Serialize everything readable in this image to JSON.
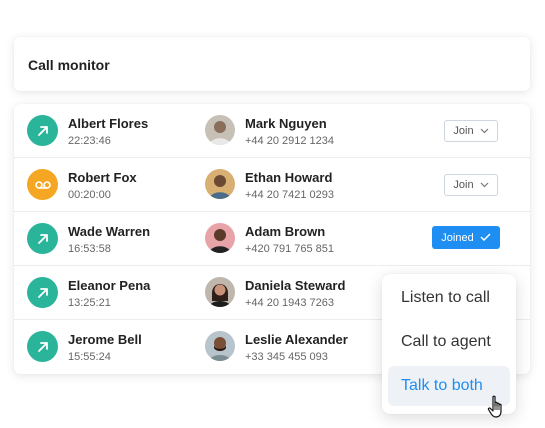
{
  "header": {
    "title": "Call monitor"
  },
  "rows": [
    {
      "caller": "Albert Flores",
      "time": "22:23:46",
      "icon": "outgoing-arrow-icon",
      "icon_color": "#2ab59a",
      "agent": "Mark Nguyen",
      "phone": "+44 20 2912 1234",
      "avatar_color": "#c7c0b6",
      "action": "Join"
    },
    {
      "caller": "Robert Fox",
      "time": "00:20:00",
      "icon": "voicemail-icon",
      "icon_color": "#f5a623",
      "agent": "Ethan Howard",
      "phone": "+44 20 7421 0293",
      "avatar_color": "#d8b073",
      "action": "Join"
    },
    {
      "caller": "Wade Warren",
      "time": "16:53:58",
      "icon": "outgoing-arrow-icon",
      "icon_color": "#2ab59a",
      "agent": "Adam Brown",
      "phone": "+420 791 765 851",
      "avatar_color": "#e7a3a8",
      "action": "Joined"
    },
    {
      "caller": "Eleanor Pena",
      "time": "13:25:21",
      "icon": "outgoing-arrow-icon",
      "icon_color": "#2ab59a",
      "agent": "Daniela Steward",
      "phone": "+44 20 1943 7263",
      "avatar_color": "#bfb6ad",
      "action": ""
    },
    {
      "caller": "Jerome Bell",
      "time": "15:55:24",
      "icon": "outgoing-arrow-icon",
      "icon_color": "#2ab59a",
      "agent": "Leslie Alexander",
      "phone": "+33 345 455 093",
      "avatar_color": "#b7c4cc",
      "action": ""
    }
  ],
  "menu": {
    "items": [
      "Listen to call",
      "Call to agent",
      "Talk to both"
    ],
    "active_index": 2,
    "accent": "#1f8ef2"
  }
}
